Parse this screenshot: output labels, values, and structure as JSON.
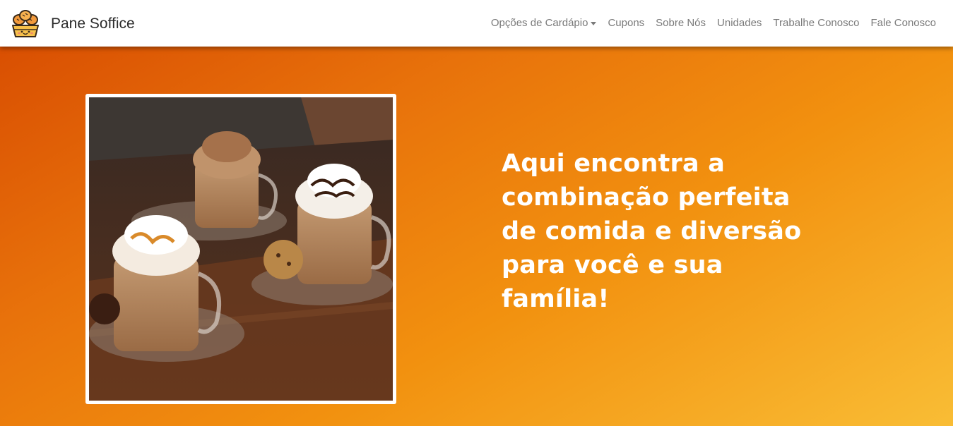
{
  "brand": {
    "name": "Pane Soffice",
    "logo_icon": "bakery-logo-icon"
  },
  "nav": {
    "items": [
      {
        "label": "Opções de Cardápio",
        "dropdown": true
      },
      {
        "label": "Cupons"
      },
      {
        "label": "Sobre Nós"
      },
      {
        "label": "Unidades"
      },
      {
        "label": "Trabalhe Conosco"
      },
      {
        "label": "Fale Conosco"
      }
    ]
  },
  "hero": {
    "image_icon": "coffee-drinks-photo",
    "headline": "Aqui encontra a\ncombinação perfeita\nde comida e diversão\npara você e sua família!"
  },
  "colors": {
    "gradient_start": "#d94f02",
    "gradient_end": "#f9bd35",
    "nav_text": "#7a7a7a",
    "brand_text": "#2b2b2b"
  }
}
